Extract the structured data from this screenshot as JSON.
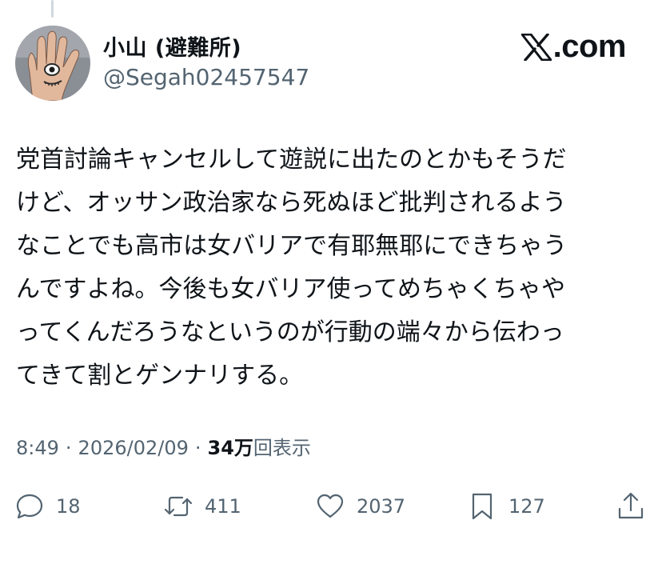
{
  "author": {
    "display_name": "小山 (避難所)",
    "handle": "@Segah02457547"
  },
  "brand": {
    "label": ".com",
    "icon": "x-logo-icon"
  },
  "tweet": {
    "lines": [
      "党首討論キャンセルして遊説に出たのとかもそうだ",
      "けど、オッサン政治家なら死ぬほど批判されるよう",
      "なことでも高市は女バリアで有耶無耶にできちゃう",
      "んですよね。今後も女バリア使ってめちゃくちゃや",
      "ってくんだろうなというのが行動の端々から伝わっ",
      "てきて割とゲンナリする。"
    ]
  },
  "meta": {
    "time": "8:49",
    "separator": "·",
    "date": "2026/02/09",
    "views_count": "34万",
    "views_label": "回表示"
  },
  "actions": {
    "replies": "18",
    "reposts": "411",
    "likes": "2037",
    "bookmarks": "127"
  }
}
